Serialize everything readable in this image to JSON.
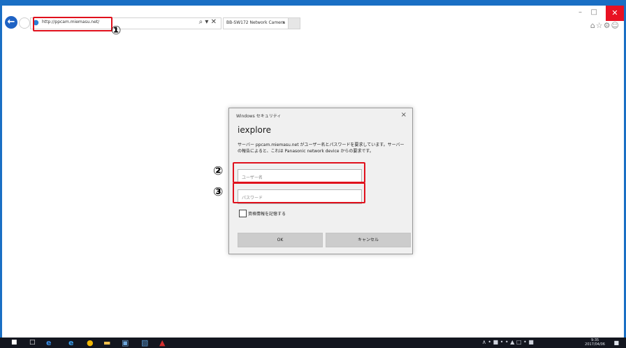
{
  "browser": {
    "back_icon": "back-arrow-icon",
    "address_url": "http://ppcam.miemasu.net/",
    "address_controls": "⌕ ▾ ✕",
    "tab_title": "BB-SW172 Network Camera",
    "tab_close": "×",
    "window_min": "–",
    "window_max": "□",
    "window_close": "✕",
    "tools": "⌂☆⚙☺"
  },
  "annotations": {
    "one": "①",
    "two": "②",
    "three": "③",
    "color": "#e0101c"
  },
  "dialog": {
    "title": "Windows セキュリティ",
    "close": "×",
    "app_name": "iexplore",
    "message": "サーバー ppcam.miemasu.net がユーザー名とパスワードを要求しています。サーバーの報告によると、これは Panasonic network device からの要求です。",
    "username_placeholder": "ユーザー名",
    "password_placeholder": "パスワード",
    "remember_label": "資格情報を記憶する",
    "ok_label": "OK",
    "cancel_label": "キャンセル"
  },
  "taskbar": {
    "start": "■",
    "task_view": "□",
    "edge": "e",
    "ie": "e",
    "chrome": "●",
    "explorer": "▬",
    "app_blue": "▣",
    "app_dark": "▧",
    "acrobat": "▲",
    "tray_icons": "∧ • ■ • • ▲ □ • ■",
    "clock_time": "9:35",
    "clock_date": "2017/04/06",
    "notifications": "■"
  }
}
